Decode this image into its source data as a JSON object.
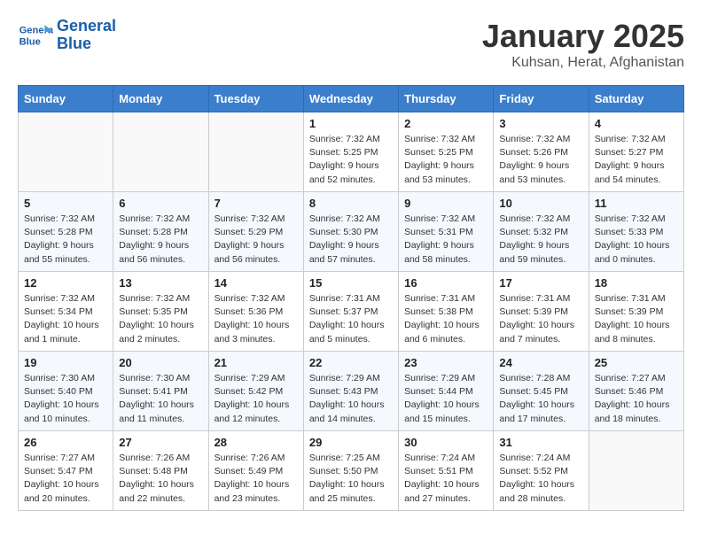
{
  "header": {
    "logo_line1": "General",
    "logo_line2": "Blue",
    "month": "January 2025",
    "location": "Kuhsan, Herat, Afghanistan"
  },
  "weekdays": [
    "Sunday",
    "Monday",
    "Tuesday",
    "Wednesday",
    "Thursday",
    "Friday",
    "Saturday"
  ],
  "weeks": [
    [
      {
        "day": "",
        "info": ""
      },
      {
        "day": "",
        "info": ""
      },
      {
        "day": "",
        "info": ""
      },
      {
        "day": "1",
        "info": "Sunrise: 7:32 AM\nSunset: 5:25 PM\nDaylight: 9 hours and 52 minutes."
      },
      {
        "day": "2",
        "info": "Sunrise: 7:32 AM\nSunset: 5:25 PM\nDaylight: 9 hours and 53 minutes."
      },
      {
        "day": "3",
        "info": "Sunrise: 7:32 AM\nSunset: 5:26 PM\nDaylight: 9 hours and 53 minutes."
      },
      {
        "day": "4",
        "info": "Sunrise: 7:32 AM\nSunset: 5:27 PM\nDaylight: 9 hours and 54 minutes."
      }
    ],
    [
      {
        "day": "5",
        "info": "Sunrise: 7:32 AM\nSunset: 5:28 PM\nDaylight: 9 hours and 55 minutes."
      },
      {
        "day": "6",
        "info": "Sunrise: 7:32 AM\nSunset: 5:28 PM\nDaylight: 9 hours and 56 minutes."
      },
      {
        "day": "7",
        "info": "Sunrise: 7:32 AM\nSunset: 5:29 PM\nDaylight: 9 hours and 56 minutes."
      },
      {
        "day": "8",
        "info": "Sunrise: 7:32 AM\nSunset: 5:30 PM\nDaylight: 9 hours and 57 minutes."
      },
      {
        "day": "9",
        "info": "Sunrise: 7:32 AM\nSunset: 5:31 PM\nDaylight: 9 hours and 58 minutes."
      },
      {
        "day": "10",
        "info": "Sunrise: 7:32 AM\nSunset: 5:32 PM\nDaylight: 9 hours and 59 minutes."
      },
      {
        "day": "11",
        "info": "Sunrise: 7:32 AM\nSunset: 5:33 PM\nDaylight: 10 hours and 0 minutes."
      }
    ],
    [
      {
        "day": "12",
        "info": "Sunrise: 7:32 AM\nSunset: 5:34 PM\nDaylight: 10 hours and 1 minute."
      },
      {
        "day": "13",
        "info": "Sunrise: 7:32 AM\nSunset: 5:35 PM\nDaylight: 10 hours and 2 minutes."
      },
      {
        "day": "14",
        "info": "Sunrise: 7:32 AM\nSunset: 5:36 PM\nDaylight: 10 hours and 3 minutes."
      },
      {
        "day": "15",
        "info": "Sunrise: 7:31 AM\nSunset: 5:37 PM\nDaylight: 10 hours and 5 minutes."
      },
      {
        "day": "16",
        "info": "Sunrise: 7:31 AM\nSunset: 5:38 PM\nDaylight: 10 hours and 6 minutes."
      },
      {
        "day": "17",
        "info": "Sunrise: 7:31 AM\nSunset: 5:39 PM\nDaylight: 10 hours and 7 minutes."
      },
      {
        "day": "18",
        "info": "Sunrise: 7:31 AM\nSunset: 5:39 PM\nDaylight: 10 hours and 8 minutes."
      }
    ],
    [
      {
        "day": "19",
        "info": "Sunrise: 7:30 AM\nSunset: 5:40 PM\nDaylight: 10 hours and 10 minutes."
      },
      {
        "day": "20",
        "info": "Sunrise: 7:30 AM\nSunset: 5:41 PM\nDaylight: 10 hours and 11 minutes."
      },
      {
        "day": "21",
        "info": "Sunrise: 7:29 AM\nSunset: 5:42 PM\nDaylight: 10 hours and 12 minutes."
      },
      {
        "day": "22",
        "info": "Sunrise: 7:29 AM\nSunset: 5:43 PM\nDaylight: 10 hours and 14 minutes."
      },
      {
        "day": "23",
        "info": "Sunrise: 7:29 AM\nSunset: 5:44 PM\nDaylight: 10 hours and 15 minutes."
      },
      {
        "day": "24",
        "info": "Sunrise: 7:28 AM\nSunset: 5:45 PM\nDaylight: 10 hours and 17 minutes."
      },
      {
        "day": "25",
        "info": "Sunrise: 7:27 AM\nSunset: 5:46 PM\nDaylight: 10 hours and 18 minutes."
      }
    ],
    [
      {
        "day": "26",
        "info": "Sunrise: 7:27 AM\nSunset: 5:47 PM\nDaylight: 10 hours and 20 minutes."
      },
      {
        "day": "27",
        "info": "Sunrise: 7:26 AM\nSunset: 5:48 PM\nDaylight: 10 hours and 22 minutes."
      },
      {
        "day": "28",
        "info": "Sunrise: 7:26 AM\nSunset: 5:49 PM\nDaylight: 10 hours and 23 minutes."
      },
      {
        "day": "29",
        "info": "Sunrise: 7:25 AM\nSunset: 5:50 PM\nDaylight: 10 hours and 25 minutes."
      },
      {
        "day": "30",
        "info": "Sunrise: 7:24 AM\nSunset: 5:51 PM\nDaylight: 10 hours and 27 minutes."
      },
      {
        "day": "31",
        "info": "Sunrise: 7:24 AM\nSunset: 5:52 PM\nDaylight: 10 hours and 28 minutes."
      },
      {
        "day": "",
        "info": ""
      }
    ]
  ]
}
